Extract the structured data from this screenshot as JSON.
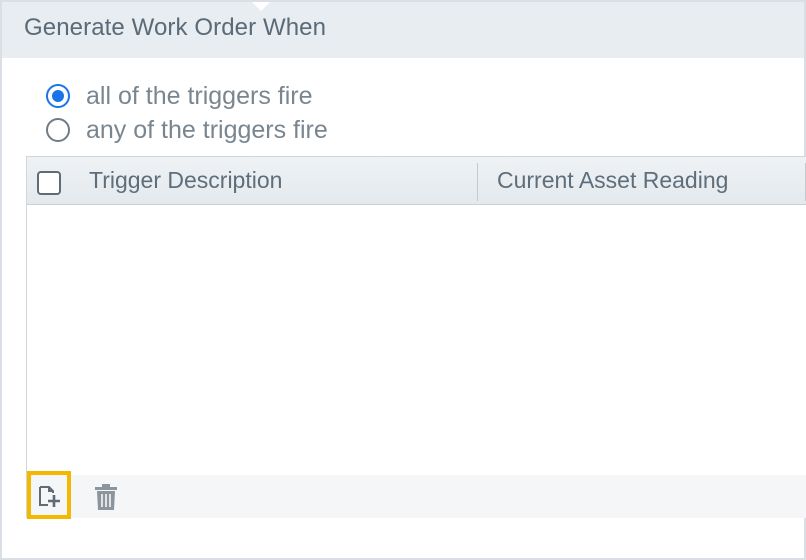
{
  "section": {
    "title": "Generate Work Order When"
  },
  "trigger_mode": {
    "options": [
      {
        "label": "all of the triggers fire",
        "selected": true
      },
      {
        "label": "any of the triggers fire",
        "selected": false
      }
    ]
  },
  "grid": {
    "columns": [
      "Trigger Description",
      "Current Asset Reading"
    ],
    "select_all_checked": false,
    "rows": []
  },
  "toolbar": {
    "add_icon": "add-document-icon",
    "delete_icon": "trash-icon",
    "highlight_color": "#f5b800"
  },
  "colors": {
    "accent": "#1a73e8",
    "header_bg": "#e8edf1"
  }
}
